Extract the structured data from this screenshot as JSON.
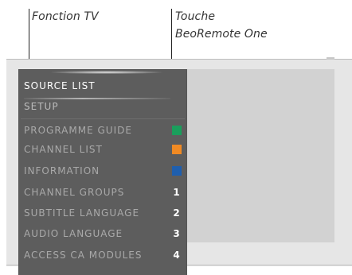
{
  "annotations": {
    "left": "Fonction TV",
    "right_line1": "Touche",
    "right_line2": "BeoRemote One"
  },
  "menu": {
    "items": [
      {
        "label": "SOURCE LIST",
        "state": "selected"
      },
      {
        "label": "SETUP"
      },
      {
        "label": "PROGRAMME GUIDE",
        "key": {
          "type": "color",
          "color": "#1a9e5c"
        }
      },
      {
        "label": "CHANNEL LIST",
        "key": {
          "type": "color",
          "color": "#f08a24"
        }
      },
      {
        "label": "INFORMATION",
        "key": {
          "type": "color",
          "color": "#1f5fae"
        }
      },
      {
        "label": "CHANNEL GROUPS",
        "key": {
          "type": "number",
          "value": "1"
        }
      },
      {
        "label": "SUBTITLE LANGUAGE",
        "key": {
          "type": "number",
          "value": "2"
        }
      },
      {
        "label": "AUDIO LANGUAGE",
        "key": {
          "type": "number",
          "value": "3"
        }
      },
      {
        "label": "ACCESS CA MODULES",
        "key": {
          "type": "number",
          "value": "4"
        }
      }
    ]
  },
  "colors": {
    "menu_background": "#5d5d5d",
    "tv_frame": "#e6e6e6",
    "tv_screen": "#d2d2d2"
  }
}
